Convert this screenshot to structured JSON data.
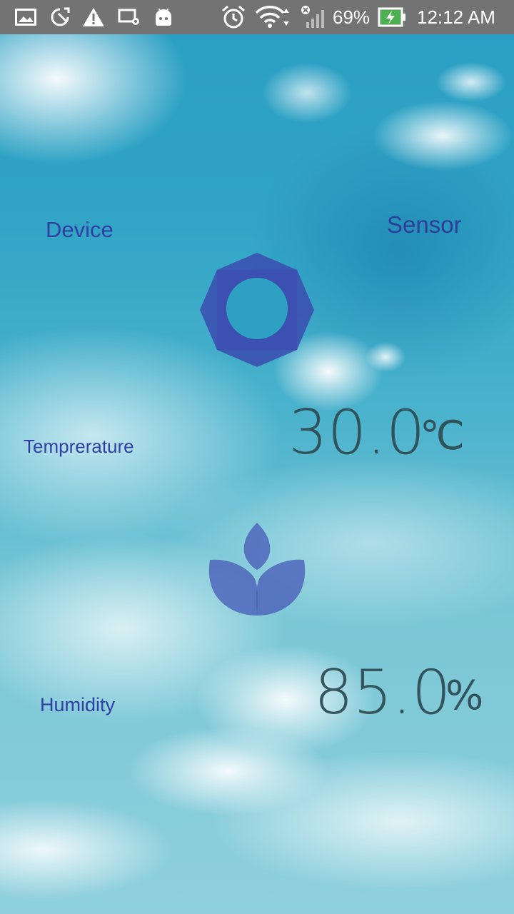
{
  "status_bar": {
    "battery_percent": "69%",
    "time": "12:12 AM",
    "icons": [
      "gallery-icon",
      "device-update-icon",
      "warning-icon",
      "screen-settings-icon",
      "android-icon",
      "alarm-icon",
      "wifi-icon",
      "no-signal-icon",
      "battery-charging-icon"
    ]
  },
  "header": {
    "device_label": "Device",
    "sensor_label": "Sensor"
  },
  "temperature": {
    "label": "Temprerature",
    "value": "30.0",
    "unit": "℃",
    "icon": "brightness-sun-icon"
  },
  "humidity": {
    "label": "Humidity",
    "value": "85.0",
    "unit": "%",
    "icon": "plant-leaf-icon"
  },
  "colors": {
    "label_blue": "#2f3fa3",
    "icon_blue": "#3b4fb0",
    "value_text": "#2d4a52",
    "status_bar": "#737373"
  }
}
